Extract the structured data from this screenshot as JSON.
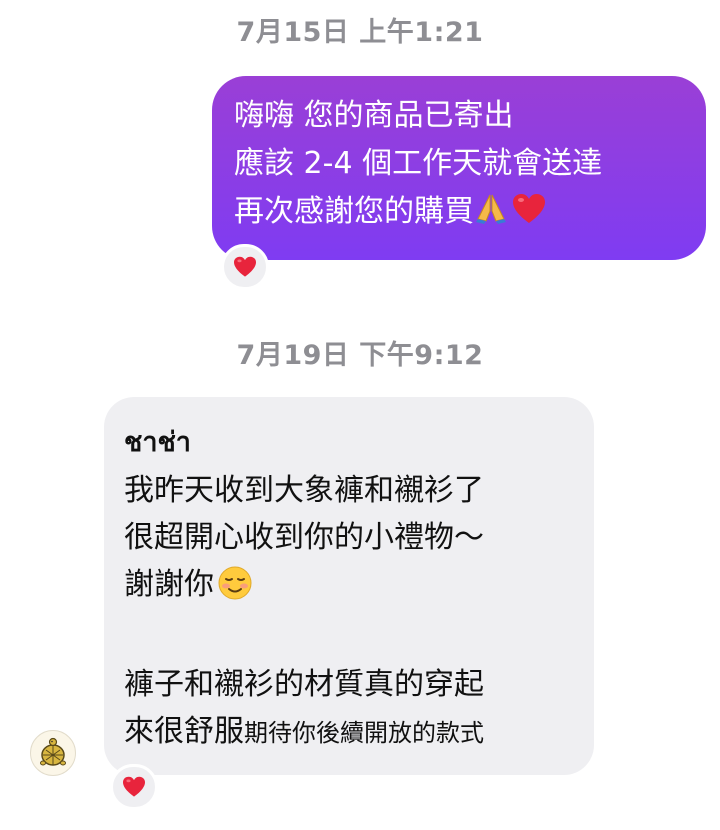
{
  "chat": {
    "timestamps": [
      "7月15日 上午1:21",
      "7月19日 下午9:12"
    ],
    "outgoing": {
      "lines": [
        "嗨嗨 您的商品已寄出",
        "應該 2-4 個工作天就會送達",
        "再次感謝您的購買"
      ],
      "emojis": [
        "folded-hands-icon",
        "red-heart-icon"
      ],
      "bubble_color": "#8a3cf0",
      "reaction": "red-heart-icon"
    },
    "incoming": {
      "sender": "ชาช่า",
      "lines": [
        "我昨天收到大象褲和襯衫了",
        "很超開心收到你的小禮物～",
        "謝謝你",
        "褲子和襯衫的材質真的穿起",
        "來很舒服"
      ],
      "small_text": "期待你後續開放的款式",
      "emoji": "smiling-face-icon",
      "bubble_color": "#efeff2",
      "reaction": "red-heart-icon"
    },
    "avatar_icon": "turtle-avatar-icon"
  }
}
